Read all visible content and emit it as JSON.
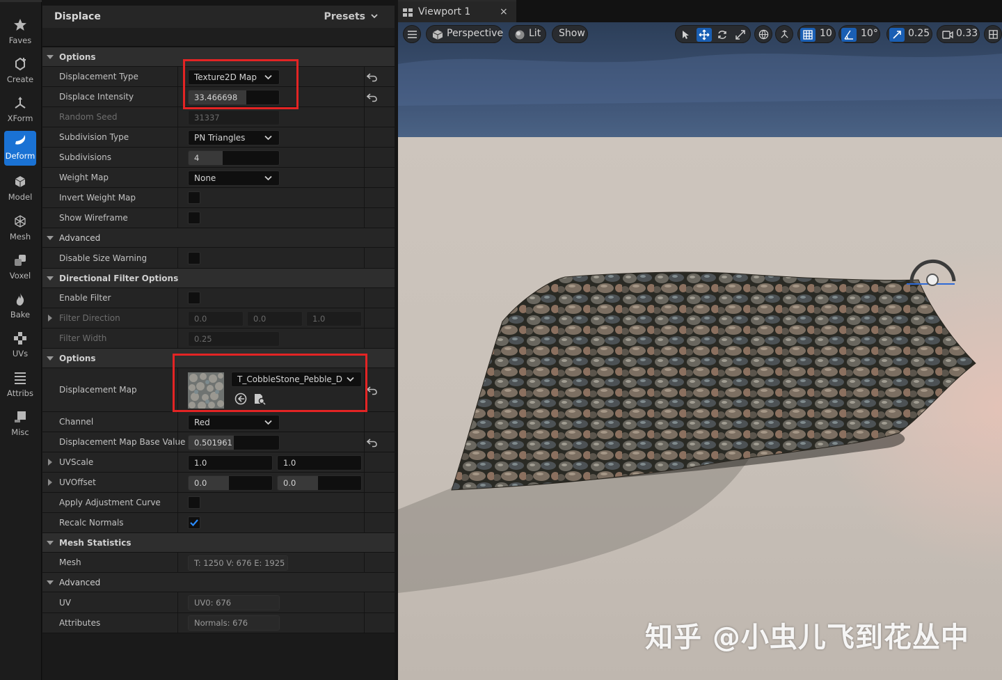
{
  "toolbar": {
    "items": [
      {
        "label": "Faves",
        "icon": "star-icon"
      },
      {
        "label": "Create",
        "icon": "create-icon"
      },
      {
        "label": "XForm",
        "icon": "xform-icon"
      },
      {
        "label": "Deform",
        "icon": "deform-icon"
      },
      {
        "label": "Model",
        "icon": "model-icon"
      },
      {
        "label": "Mesh",
        "icon": "mesh-icon"
      },
      {
        "label": "Voxel",
        "icon": "voxel-icon"
      },
      {
        "label": "Bake",
        "icon": "bake-icon"
      },
      {
        "label": "UVs",
        "icon": "uvs-icon"
      },
      {
        "label": "Attribs",
        "icon": "attribs-icon"
      },
      {
        "label": "Misc",
        "icon": "misc-icon"
      }
    ],
    "active": "Deform",
    "accent": "#1a72d4"
  },
  "panel": {
    "title": "Displace",
    "presets_label": "Presets",
    "sections": {
      "options": "Options",
      "advanced": "Advanced",
      "directional": "Directional Filter Options",
      "options2": "Options",
      "mesh_stats": "Mesh Statistics",
      "advanced2": "Advanced"
    },
    "props": {
      "displacement_type": {
        "label": "Displacement Type",
        "value": "Texture2D Map"
      },
      "displace_intensity": {
        "label": "Displace Intensity",
        "value": "33.466698"
      },
      "random_seed": {
        "label": "Random Seed",
        "value": "31337"
      },
      "subdivision_type": {
        "label": "Subdivision Type",
        "value": "PN Triangles"
      },
      "subdivisions": {
        "label": "Subdivisions",
        "value": "4"
      },
      "weight_map": {
        "label": "Weight Map",
        "value": "None"
      },
      "invert_weight_map": {
        "label": "Invert Weight Map",
        "checked": false
      },
      "show_wireframe": {
        "label": "Show Wireframe",
        "checked": false
      },
      "disable_size_warning": {
        "label": "Disable Size Warning",
        "checked": false
      },
      "enable_filter": {
        "label": "Enable Filter",
        "checked": false
      },
      "filter_direction": {
        "label": "Filter Direction",
        "x": "0.0",
        "y": "0.0",
        "z": "1.0"
      },
      "filter_width": {
        "label": "Filter Width",
        "value": "0.25"
      },
      "displacement_map": {
        "label": "Displacement Map",
        "value": "T_CobbleStone_Pebble_D"
      },
      "channel": {
        "label": "Channel",
        "value": "Red"
      },
      "map_base_value": {
        "label": "Displacement Map Base Value",
        "value": "0.501961"
      },
      "uvscale": {
        "label": "UVScale",
        "x": "1.0",
        "y": "1.0"
      },
      "uvoffset": {
        "label": "UVOffset",
        "x": "0.0",
        "y": "0.0"
      },
      "apply_adjustment_curve": {
        "label": "Apply Adjustment Curve",
        "checked": false
      },
      "recalc_normals": {
        "label": "Recalc Normals",
        "checked": true
      },
      "mesh": {
        "label": "Mesh",
        "value": "T: 1250  V: 676  E: 1925"
      },
      "uv": {
        "label": "UV",
        "value": "UV0: 676"
      },
      "attributes": {
        "label": "Attributes",
        "value": "Normals: 676"
      }
    },
    "highlight_color": "#e32424"
  },
  "viewport": {
    "tab_label": "Viewport 1",
    "close_glyph": "×",
    "perspective_label": "Perspective",
    "lit_label": "Lit",
    "show_label": "Show",
    "grid_snap": "10",
    "rotation_snap": "10°",
    "scale_snap": "0.25",
    "camera_speed": "0.33",
    "watermark": "知乎 @小虫儿飞到花丛中"
  }
}
